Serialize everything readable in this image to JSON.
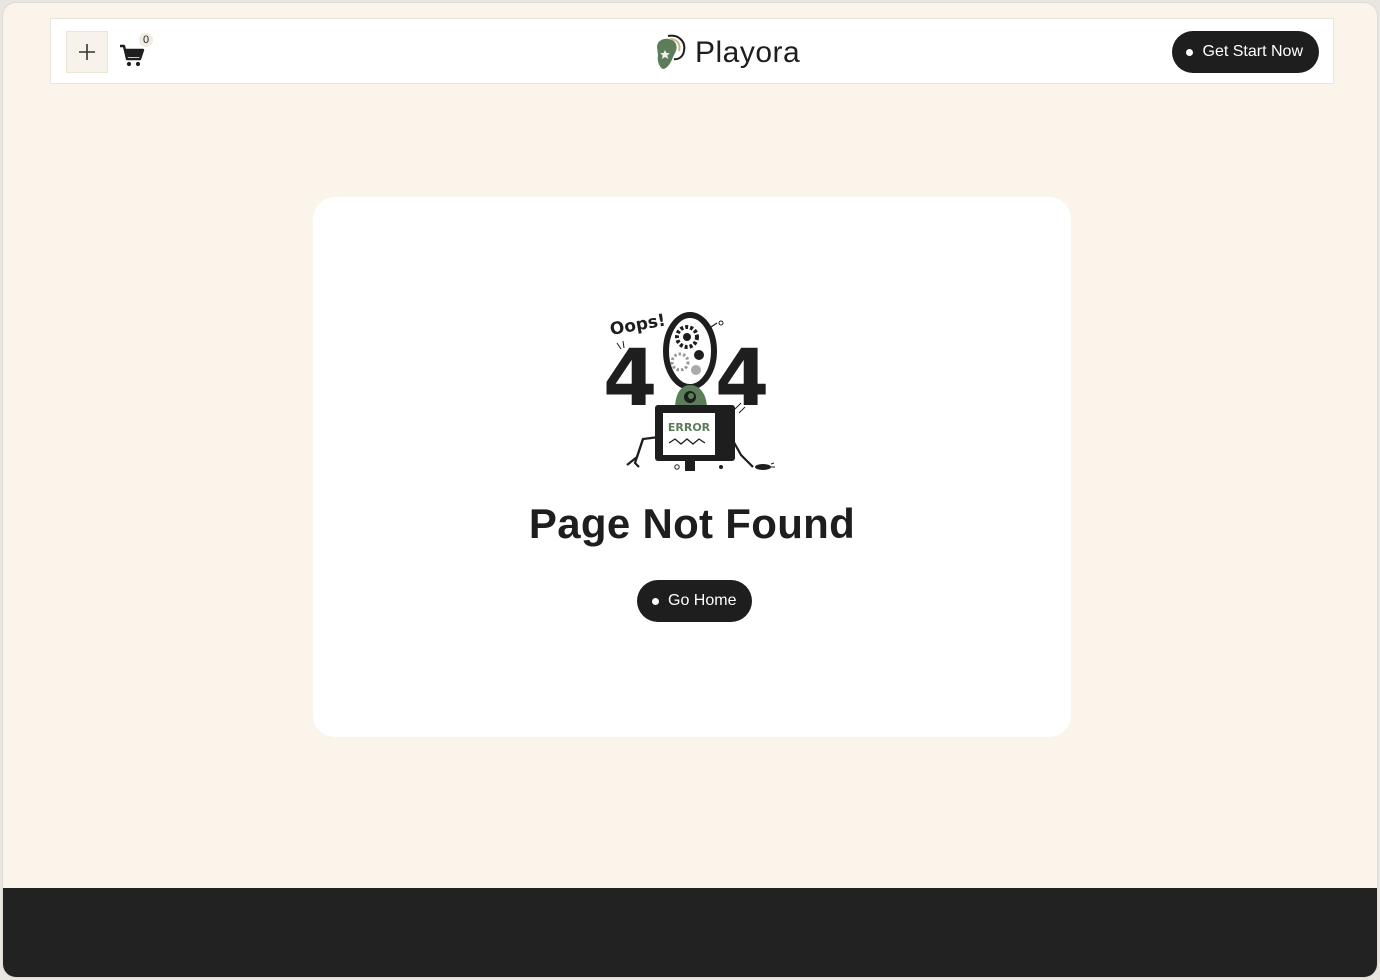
{
  "header": {
    "menu_icon": "plus-icon",
    "cart_icon": "cart-icon",
    "cart_count": "0",
    "brand_name": "Playora",
    "cta_label": "Get Start Now"
  },
  "error": {
    "illustration_text_oops": "Oops!",
    "illustration_text_404_left": "4",
    "illustration_text_404_right": "4",
    "illustration_text_error": "ERROR",
    "title": "Page Not Found",
    "button_label": "Go Home"
  },
  "colors": {
    "background": "#faf4eb",
    "card": "#ffffff",
    "dark": "#1e1e1e",
    "accent_green": "#5b7d59",
    "footer": "#222222"
  }
}
